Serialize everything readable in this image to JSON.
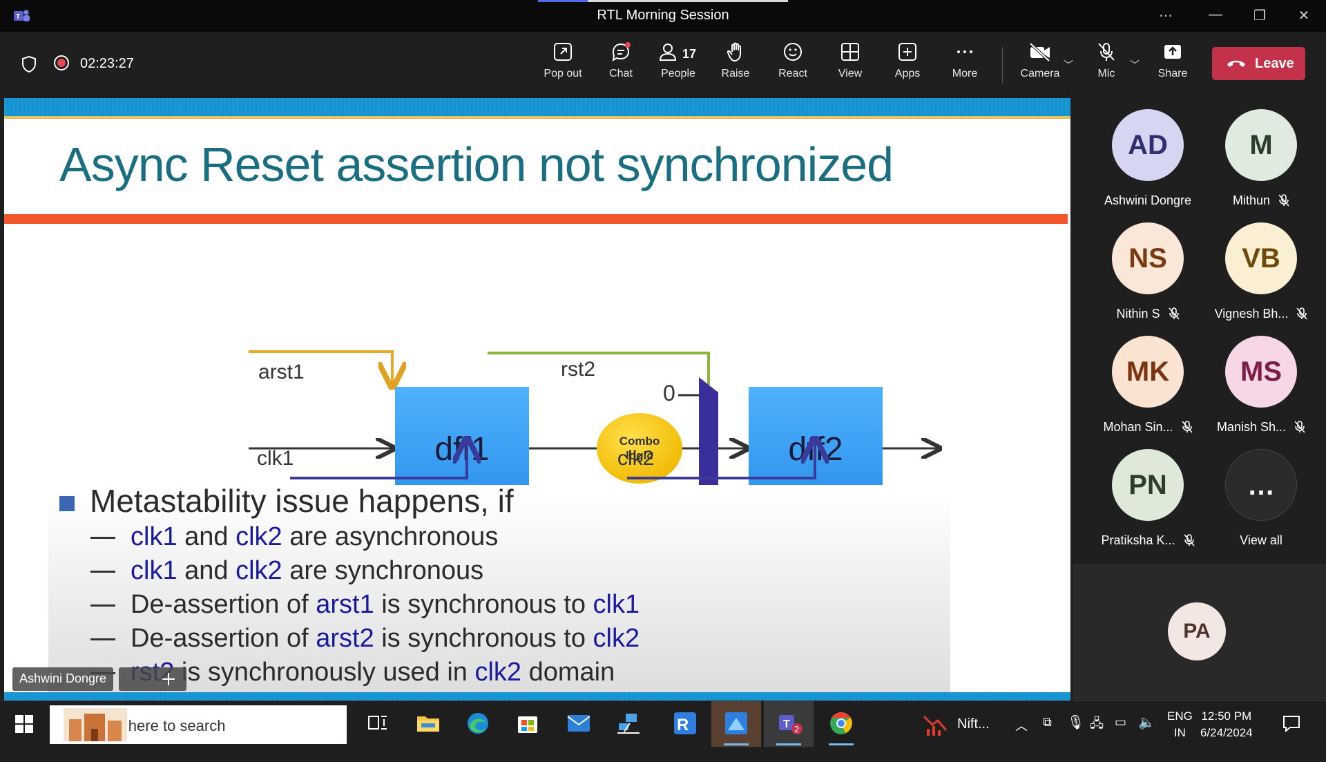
{
  "window": {
    "title": "RTL Morning Session",
    "controls": [
      "more-options",
      "minimize",
      "restore",
      "close"
    ]
  },
  "meeting": {
    "recording_time": "02:23:27",
    "toolbar": {
      "popout": "Pop out",
      "chat": "Chat",
      "people": "People",
      "people_count": "17",
      "raise": "Raise",
      "react": "React",
      "view": "View",
      "apps": "Apps",
      "more": "More",
      "camera": "Camera",
      "mic": "Mic",
      "share": "Share",
      "leave": "Leave"
    }
  },
  "slide": {
    "title": "Async Reset assertion not synchronized",
    "diagram": {
      "arst1": "arst1",
      "rst2": "rst2",
      "zero": "0",
      "dff1": "dff1",
      "dff2": "dff2",
      "combo_line1": "Combo",
      "combo_line2": "logic",
      "clk1": "clk1",
      "clk2": "clk2"
    },
    "bullet": "Metastability issue happens, if",
    "subs": [
      {
        "a": "clk1",
        "b": " and ",
        "c": "clk2",
        "d": " are asynchronous",
        "e": ""
      },
      {
        "a": "clk1",
        "b": " and ",
        "c": "clk2",
        "d": " are synchronous",
        "e": ""
      },
      {
        "a": "De-assertion of ",
        "b": "arst1",
        "c": " is synchronous to ",
        "d": "clk1",
        "e": ""
      },
      {
        "a": "De-assertion of ",
        "b": "arst2",
        "c": " is synchronous to ",
        "d": "clk2",
        "e": ""
      },
      {
        "a": "rst2",
        "b": " is synchronously used in ",
        "c": "clk2",
        "d": " domain",
        "e": ""
      }
    ]
  },
  "presenter_tag": "Ashwini Dongre",
  "participants": [
    {
      "initials": "AD",
      "name": "Ashwini Dongre",
      "muted": false,
      "bg": "#d6d6f2",
      "fg": "#2f2f6e"
    },
    {
      "initials": "M",
      "name": "Mithun",
      "muted": true,
      "bg": "#e0ebe0",
      "fg": "#2b3d2b"
    },
    {
      "initials": "NS",
      "name": "Nithin S",
      "muted": true,
      "bg": "#fbe7d8",
      "fg": "#7a3a12"
    },
    {
      "initials": "VB",
      "name": "Vignesh Bh...",
      "muted": true,
      "bg": "#fbefd3",
      "fg": "#6e4a08"
    },
    {
      "initials": "MK",
      "name": "Mohan Sin...",
      "muted": true,
      "bg": "#fbe3d2",
      "fg": "#7a3412"
    },
    {
      "initials": "MS",
      "name": "Manish Sh...",
      "muted": true,
      "bg": "#f7d7e6",
      "fg": "#7a1d47"
    },
    {
      "initials": "PN",
      "name": "Pratiksha K...",
      "muted": true,
      "bg": "#dfe9da",
      "fg": "#2b3d2b"
    },
    {
      "initials": "…",
      "name": "View all",
      "muted": false,
      "bg": "#2a2a2a",
      "fg": "#ffffff"
    }
  ],
  "self_view": {
    "initials": "PA"
  },
  "taskbar": {
    "search_placeholder": "Type here to search",
    "nifty_label": "Nift...",
    "teams_badge": "2",
    "lang_top": "ENG",
    "lang_bottom": "IN",
    "time": "12:50 PM",
    "date": "6/24/2024"
  },
  "colors": {
    "leave": "#c4314b",
    "slide_title": "#1a6e82",
    "slide_redbar": "#f4562b",
    "dff_box": "#2f9bf0",
    "combo": "#f7c300",
    "mux": "#3a2f9a"
  }
}
